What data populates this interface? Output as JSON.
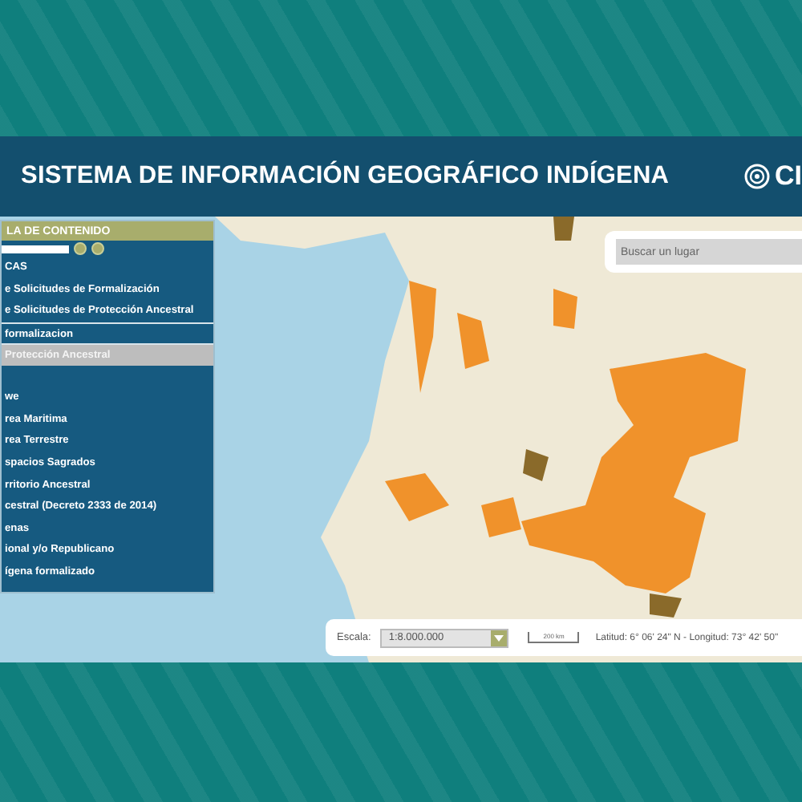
{
  "header": {
    "title": "SISTEMA DE INFORMACIÓN GEOGRÁFICO INDÍGENA",
    "logo_text": "CI"
  },
  "panel": {
    "title": "LA DE CONTENIDO",
    "items": [
      {
        "label": "CAS",
        "kind": "layer",
        "selected": false
      },
      {
        "label": "e Solicitudes de Formalización",
        "kind": "layer",
        "selected": false
      },
      {
        "label": "e Solicitudes de Protección Ancestral",
        "kind": "layer",
        "selected": false
      },
      {
        "label": "formalizacion",
        "kind": "folder",
        "selected": false
      },
      {
        "label": "Protección Ancestral",
        "kind": "folder",
        "selected": true
      },
      {
        "label": "we",
        "kind": "layer",
        "selected": false
      },
      {
        "label": "rea Maritima",
        "kind": "layer",
        "selected": false
      },
      {
        "label": "rea Terrestre",
        "kind": "layer",
        "selected": false
      },
      {
        "label": "spacios Sagrados",
        "kind": "layer",
        "selected": false
      },
      {
        "label": "rritorio Ancestral",
        "kind": "layer",
        "selected": false
      },
      {
        "label": "cestral (Decreto 2333 de 2014)",
        "kind": "layer",
        "selected": false
      },
      {
        "label": "enas",
        "kind": "layer",
        "selected": false
      },
      {
        "label": "ional y/o Republicano",
        "kind": "layer",
        "selected": false
      },
      {
        "label": "ígena formalizado",
        "kind": "layer",
        "selected": false
      }
    ]
  },
  "search": {
    "placeholder": "Buscar un lugar"
  },
  "footer": {
    "scale_label": "Escala:",
    "scale_value": "1:8.000.000",
    "scale_bar": "200 km",
    "coordinates": "Latitud: 6° 06' 24\" N - Longitud: 73° 42' 50\""
  }
}
